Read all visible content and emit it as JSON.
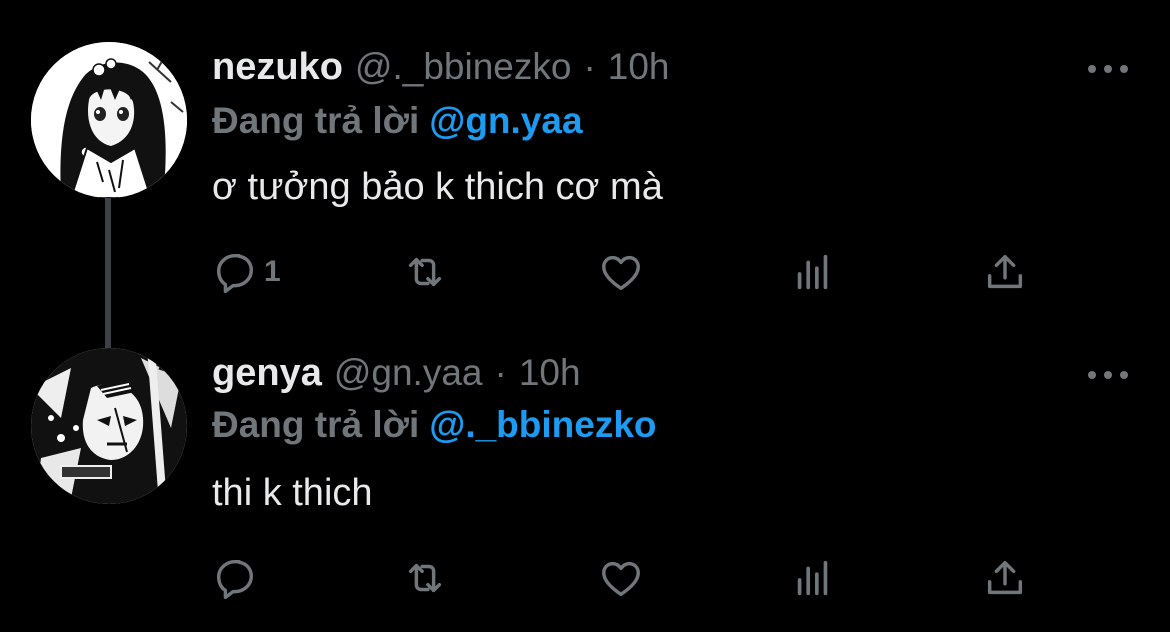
{
  "tweets": [
    {
      "display_name": "nezuko",
      "handle": "@._bbinezko",
      "separator": "·",
      "time": "10h",
      "reply_label": "Đang trả lời",
      "reply_mention": "@gn.yaa",
      "text": "ơ tưởng bảo k thich cơ mà",
      "reply_count": "1",
      "avatar_icon": "anime-girl-avatar"
    },
    {
      "display_name": "genya",
      "handle": "@gn.yaa",
      "separator": "·",
      "time": "10h",
      "reply_label": "Đang trả lời",
      "reply_mention": "@._bbinezko",
      "text": "thi k thich",
      "reply_count": "",
      "avatar_icon": "anime-boy-avatar"
    }
  ],
  "colors": {
    "background": "#000000",
    "primary_text": "#e7e9ea",
    "secondary_text": "#71767b",
    "mention": "#1d9bf0",
    "thread_line": "#3d4147"
  },
  "icons": [
    "reply-icon",
    "retweet-icon",
    "like-icon",
    "views-icon",
    "share-icon",
    "more-icon"
  ]
}
